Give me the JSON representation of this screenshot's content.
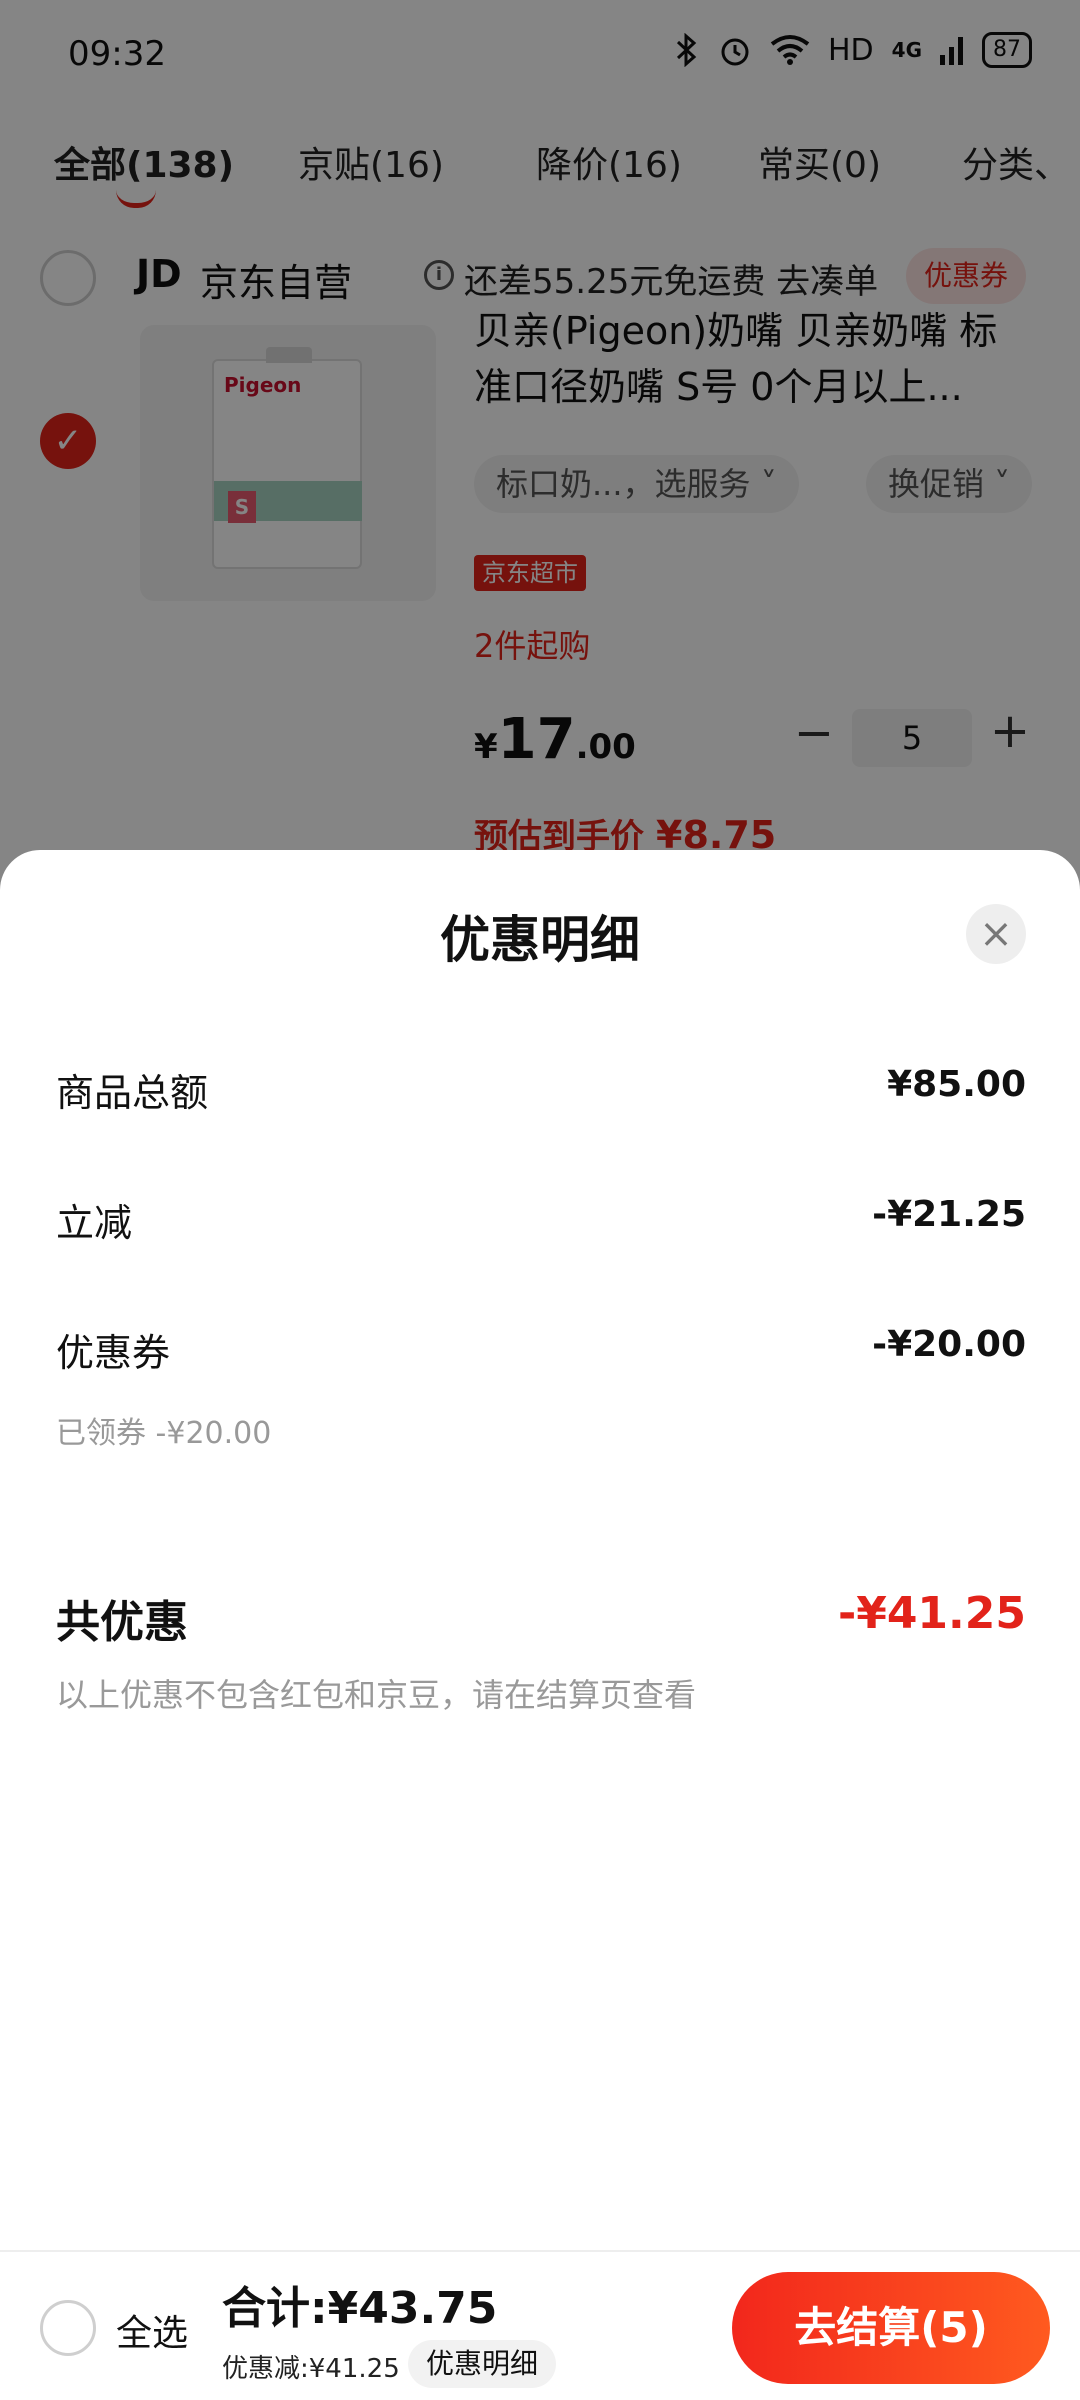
{
  "status_bar": {
    "time": "09:32",
    "bluetooth_icon": "bluetooth-icon",
    "alarm_icon": "alarm-icon",
    "wifi_icon": "wifi-icon",
    "hd": "HD",
    "signal": "4G",
    "battery": "87"
  },
  "tabs": [
    {
      "label": "全部(138)"
    },
    {
      "label": "京贴(16)"
    },
    {
      "label": "降价(16)"
    },
    {
      "label": "常买(0)"
    },
    {
      "label": "分类、"
    }
  ],
  "store": {
    "logo": "JD",
    "name": "京东自营",
    "shipping_note": "还差55.25元免运费 去凑单",
    "coupon_badge": "优惠券"
  },
  "product": {
    "title": "贝亲(Pigeon)奶嘴 贝亲奶嘴 标准口径奶嘴 S号 0个月以上...",
    "package_brand": "Pigeon",
    "service_chip": "标口奶...，选服务 ˅",
    "promo_chip": "换促销 ˅",
    "tag": "京东超市",
    "min_buy": "2件起购",
    "price_currency": "¥",
    "price_int": "17",
    "price_dec": ".00",
    "quantity": "5",
    "est_label": "预估到手价",
    "est_value": "¥8.75"
  },
  "sheet": {
    "title": "优惠明细",
    "rows": [
      {
        "label": "商品总额",
        "value": "¥85.00"
      },
      {
        "label": "立减",
        "value": "-¥21.25"
      },
      {
        "label": "优惠券",
        "value": "-¥20.00",
        "sub": "已领券 -¥20.00"
      }
    ],
    "total_label": "共优惠",
    "total_value": "-¥41.25",
    "note": "以上优惠不包含红包和京豆，请在结算页查看"
  },
  "bottom_bar": {
    "select_all": "全选",
    "sum": "合计:¥43.75",
    "discount": "优惠减:¥41.25",
    "detail": "优惠明细",
    "checkout": "去结算(5)"
  },
  "colors": {
    "accent": "#e2231a",
    "overlay": "rgba(0,0,0,0.48)"
  }
}
